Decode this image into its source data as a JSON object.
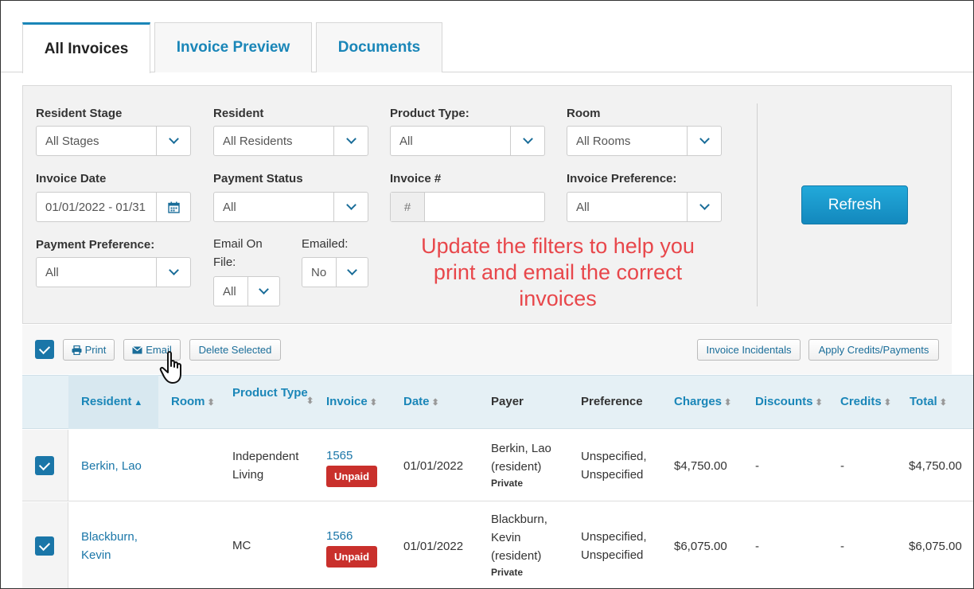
{
  "tabs": [
    {
      "label": "All Invoices",
      "active": true
    },
    {
      "label": "Invoice Preview",
      "active": false
    },
    {
      "label": "Documents",
      "active": false
    }
  ],
  "filters": {
    "resident_stage": {
      "label": "Resident Stage",
      "value": "All Stages"
    },
    "resident": {
      "label": "Resident",
      "value": "All Residents"
    },
    "product_type": {
      "label": "Product Type:",
      "value": "All"
    },
    "room": {
      "label": "Room",
      "value": "All Rooms"
    },
    "invoice_date": {
      "label": "Invoice Date",
      "value": "01/01/2022 - 01/31"
    },
    "payment_status": {
      "label": "Payment Status",
      "value": "All"
    },
    "invoice_number": {
      "label": "Invoice #",
      "prefix": "#",
      "value": ""
    },
    "invoice_preference": {
      "label": "Invoice Preference:",
      "value": "All"
    },
    "payment_preference": {
      "label": "Payment Preference:",
      "value": "All"
    },
    "email_on_file": {
      "label": "Email On File:",
      "value": "All"
    },
    "emailed": {
      "label": "Emailed:",
      "value": "No"
    }
  },
  "refresh_label": "Refresh",
  "annotation": "Update the filters to help you print and email the correct invoices",
  "actions": {
    "print": "Print",
    "email": "Email",
    "delete_selected": "Delete Selected",
    "invoice_incidentals": "Invoice Incidentals",
    "apply_credits": "Apply Credits/Payments"
  },
  "columns": {
    "resident": "Resident",
    "room": "Room",
    "product_type": "Product Type",
    "invoice": "Invoice",
    "date": "Date",
    "payer": "Payer",
    "preference": "Preference",
    "charges": "Charges",
    "discounts": "Discounts",
    "credits": "Credits",
    "total": "Total"
  },
  "rows": [
    {
      "resident": "Berkin, Lao",
      "product_type": "Independent Living",
      "invoice": "1565",
      "status": "Unpaid",
      "date": "01/01/2022",
      "payer": "Berkin, Lao (resident)",
      "payer_type": "Private",
      "preference": "Unspecified, Unspecified",
      "charges": "$4,750.00",
      "discounts": "-",
      "credits": "-",
      "total": "$4,750.00"
    },
    {
      "resident": "Blackburn, Kevin",
      "product_type": "MC",
      "invoice": "1566",
      "status": "Unpaid",
      "date": "01/01/2022",
      "payer": "Blackburn, Kevin (resident)",
      "payer_type": "Private",
      "preference": "Unspecified, Unspecified",
      "charges": "$6,075.00",
      "discounts": "-",
      "credits": "-",
      "total": "$6,075.00"
    }
  ],
  "colors": {
    "accent": "#1a86b8",
    "refresh": "#1a9fd4",
    "unpaid": "#c9302c",
    "annotation": "#e8474b"
  },
  "icons": {
    "calendar": "calendar-icon",
    "print": "print-icon",
    "email": "envelope-icon",
    "cursor": "hand-pointer-icon"
  }
}
